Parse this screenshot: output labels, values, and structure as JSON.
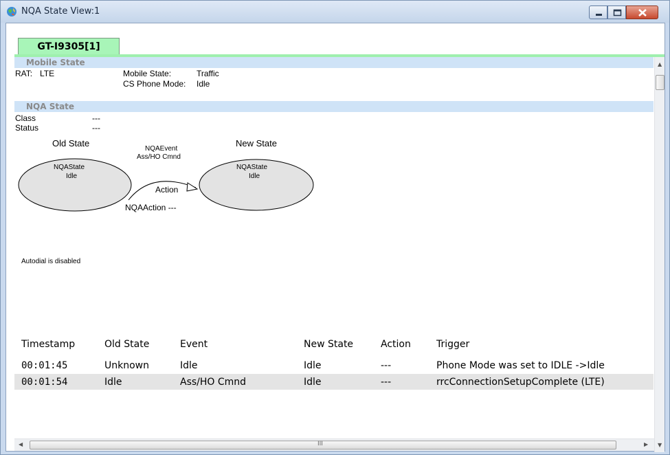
{
  "window": {
    "title": "NQA State View:1",
    "icon": "app-globe-icon"
  },
  "tabs": [
    {
      "label": "GT-I9305[1]",
      "active": true
    }
  ],
  "mobile_state": {
    "header": "Mobile State",
    "rat_label": "RAT:",
    "rat_value": "LTE",
    "mobile_state_label": "Mobile State:",
    "mobile_state_value": "Traffic",
    "cs_phone_mode_label": "CS Phone Mode:",
    "cs_phone_mode_value": "Idle"
  },
  "nqa_state": {
    "header": "NQA State",
    "class_label": "Class",
    "class_value": "---",
    "status_label": "Status",
    "status_value": "---"
  },
  "diagram": {
    "old_state_title": "Old State",
    "old_state_line1": "NQAState",
    "old_state_line2": "Idle",
    "new_state_title": "New State",
    "new_state_line1": "NQAState",
    "new_state_line2": "Idle",
    "event_line1": "NQAEvent",
    "event_line2": "Ass/HO Cmnd",
    "action_label": "Action",
    "nqa_action": "NQAAction ---"
  },
  "autodial_text": "Autodial is disabled",
  "table": {
    "columns": [
      "Timestamp",
      "Old State",
      "Event",
      "New State",
      "Action",
      "Trigger"
    ],
    "rows": [
      [
        "00:01:45",
        "Unknown",
        "Idle",
        "Idle",
        "---",
        "Phone Mode was set to IDLE ->Idle"
      ],
      [
        "00:01:54",
        "Idle",
        "Ass/HO Cmnd",
        "Idle",
        "---",
        "rrcConnectionSetupComplete (LTE)"
      ]
    ]
  },
  "hscroll_grip": "III",
  "colors": {
    "tab_active": "#a8f5b8",
    "section_header": "#cfe3f7",
    "selected_row": "#e4e4e4"
  }
}
